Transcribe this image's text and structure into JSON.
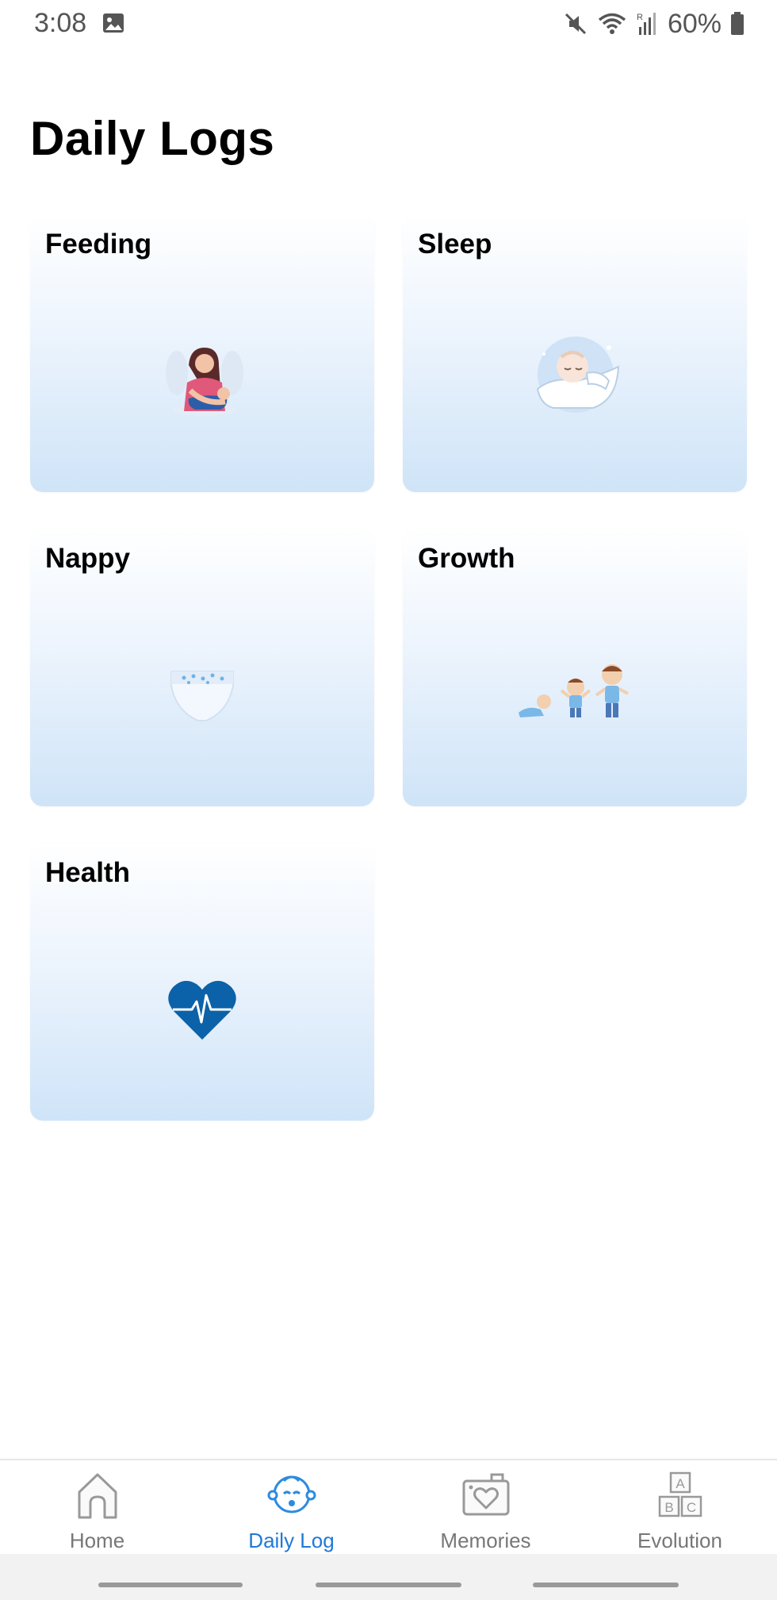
{
  "status_bar": {
    "time": "3:08",
    "battery": "60%",
    "icons": [
      "gallery-icon",
      "mute-icon",
      "wifi-icon",
      "signal-icon",
      "battery-icon"
    ]
  },
  "page": {
    "title": "Daily Logs"
  },
  "cards": [
    {
      "label": "Feeding",
      "icon": "feeding-illustration"
    },
    {
      "label": "Sleep",
      "icon": "sleeping-baby-illustration"
    },
    {
      "label": "Nappy",
      "icon": "nappy-illustration"
    },
    {
      "label": "Growth",
      "icon": "growth-illustration"
    },
    {
      "label": "Health",
      "icon": "heart-pulse-icon"
    }
  ],
  "bottom_nav": {
    "items": [
      {
        "label": "Home",
        "icon": "home-icon",
        "active": false
      },
      {
        "label": "Daily Log",
        "icon": "baby-face-icon",
        "active": true
      },
      {
        "label": "Memories",
        "icon": "camera-heart-icon",
        "active": false
      },
      {
        "label": "Evolution",
        "icon": "abc-blocks-icon",
        "active": false
      }
    ]
  },
  "colors": {
    "accent": "#1f7ad6",
    "card_gradient_top": "#ffffff",
    "card_gradient_bottom": "#cfe4f8",
    "heart": "#0b62a8",
    "inactive_nav": "#777777"
  }
}
